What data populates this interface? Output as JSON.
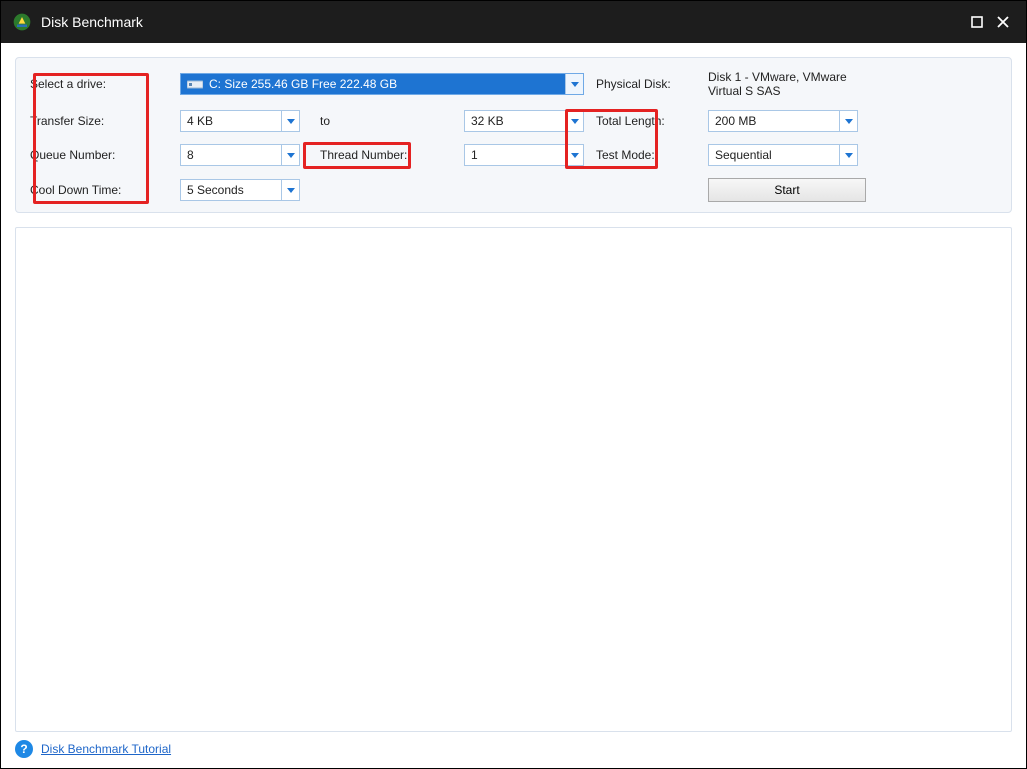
{
  "window": {
    "title": "Disk Benchmark"
  },
  "labels": {
    "select_drive": "Select a drive:",
    "physical_disk": "Physical Disk:",
    "transfer_size": "Transfer Size:",
    "to": "to",
    "total_length": "Total Length:",
    "queue_number": "Queue Number:",
    "thread_number": "Thread Number:",
    "test_mode": "Test Mode:",
    "cool_down": "Cool Down Time:"
  },
  "values": {
    "drive": "C:  Size 255.46 GB  Free 222.48 GB",
    "physical_disk": "Disk 1 - VMware, VMware Virtual S SAS",
    "transfer_from": "4 KB",
    "transfer_to": "32 KB",
    "total_length": "200 MB",
    "queue": "8",
    "thread": "1",
    "test_mode": "Sequential",
    "cool_down": "5 Seconds"
  },
  "buttons": {
    "start": "Start"
  },
  "footer": {
    "tutorial": "Disk Benchmark Tutorial"
  }
}
